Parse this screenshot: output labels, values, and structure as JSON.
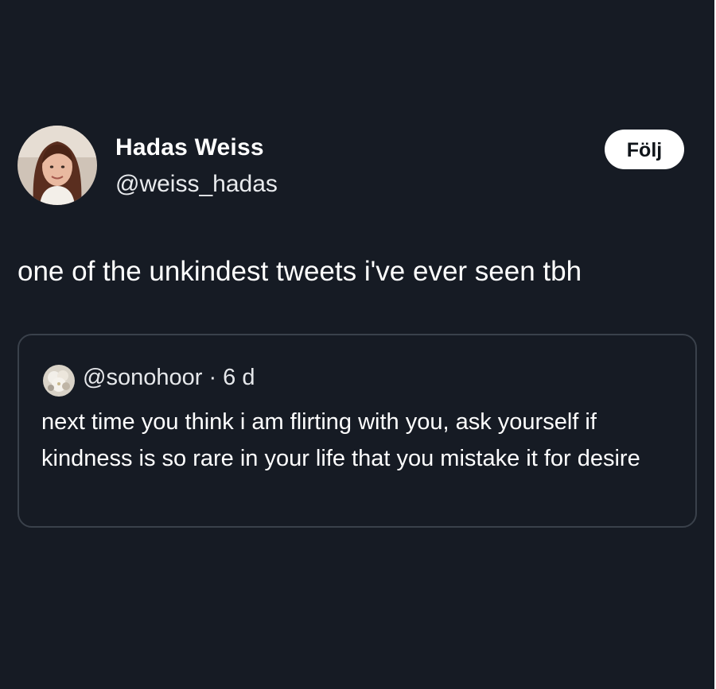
{
  "tweet": {
    "author": {
      "display_name": "Hadas Weiss",
      "handle": "@weiss_hadas",
      "avatar_icon": "avatar-photo"
    },
    "follow_label": "Följ",
    "text": "one of the unkindest tweets i've ever seen tbh"
  },
  "quoted_tweet": {
    "handle": "@sonohoor",
    "separator": "·",
    "time": "6 d",
    "text": "next time you think i am flirting with you, ask yourself if kindness is so rare in your life that you mistake it for desire"
  },
  "colors": {
    "background": "#161b24",
    "text": "#ffffff",
    "card_border": "#3a414b",
    "button_bg": "#ffffff",
    "button_text": "#0f1419"
  }
}
